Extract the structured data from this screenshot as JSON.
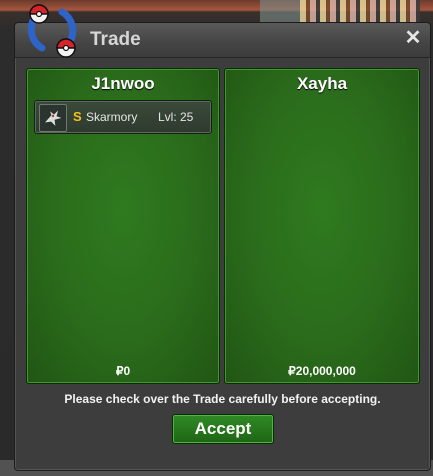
{
  "window": {
    "title": "Trade",
    "close_symbol": "✕"
  },
  "left_panel": {
    "player_name": "J1nwoo",
    "items": [
      {
        "coin_symbol": "S",
        "pokemon": "Skarmory",
        "level": "Lvl: 25"
      }
    ],
    "money": "₽0"
  },
  "right_panel": {
    "player_name": "Xayha",
    "money": "₽20,000,000"
  },
  "notice": "Please check over the Trade carefully before accepting.",
  "accept_label": "Accept",
  "colors": {
    "panel_green": "#2a6b1b",
    "accept_green": "#2f8a24",
    "coin_gold": "#f2c21a"
  },
  "icons": {
    "logo": "pokeball-emblem-icon",
    "item_sprite": "skarmory-sprite-icon"
  }
}
